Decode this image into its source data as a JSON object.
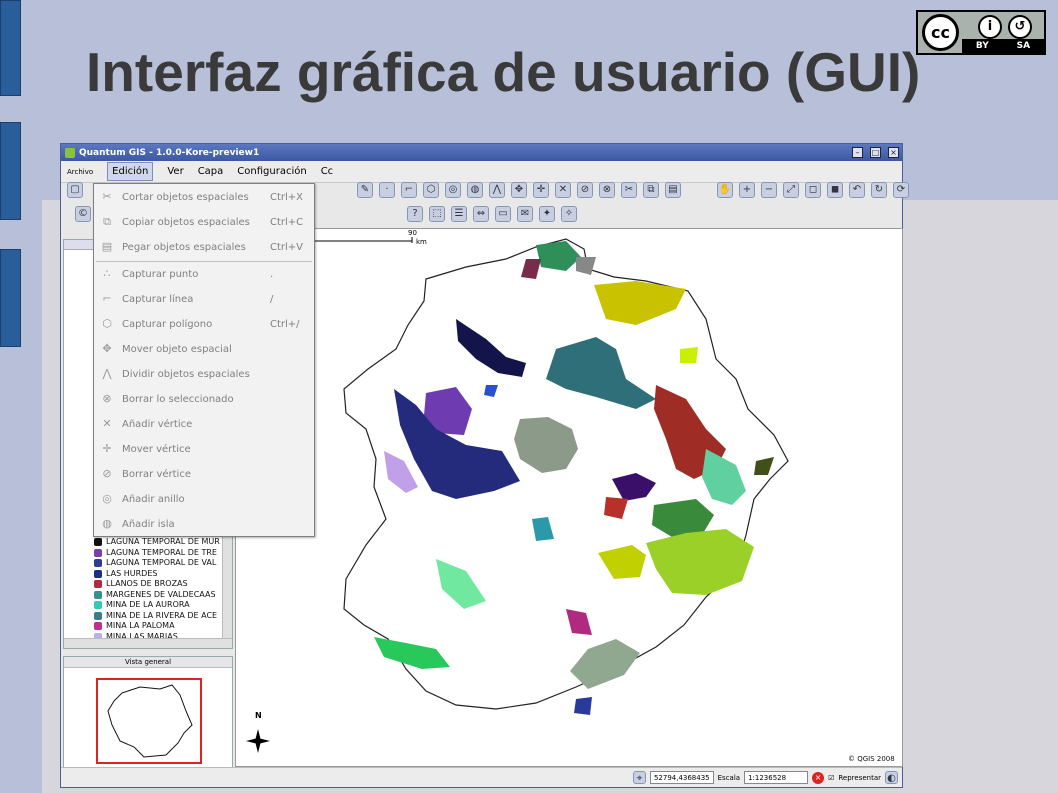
{
  "slide": {
    "title": "Interfaz gráfica de usuario (GUI)"
  },
  "license": {
    "cc": "cc",
    "by": "BY",
    "sa": "SA"
  },
  "window": {
    "title": "Quantum GIS - 1.0.0-Kore-preview1"
  },
  "menubar": {
    "archivo": "Archivo",
    "edicion": "Edición",
    "ver": "Ver",
    "capa": "Capa",
    "configuracion": "Configuración",
    "complementos": "Cc"
  },
  "edit_menu": [
    {
      "label": "Cortar objetos espaciales",
      "shortcut": "Ctrl+X",
      "icon": "scissors-icon"
    },
    {
      "label": "Copiar objetos espaciales",
      "shortcut": "Ctrl+C",
      "icon": "copy-icon"
    },
    {
      "label": "Pegar objetos espaciales",
      "shortcut": "Ctrl+V",
      "icon": "paste-icon"
    },
    {
      "label": "Capturar punto",
      "shortcut": ".",
      "icon": "capture-point-icon"
    },
    {
      "label": "Capturar línea",
      "shortcut": "/",
      "icon": "capture-line-icon"
    },
    {
      "label": "Capturar polígono",
      "shortcut": "Ctrl+/",
      "icon": "capture-polygon-icon"
    },
    {
      "label": "Mover objeto espacial",
      "shortcut": "",
      "icon": "move-feature-icon"
    },
    {
      "label": "Dividir objetos espaciales",
      "shortcut": "",
      "icon": "split-feature-icon"
    },
    {
      "label": "Borrar lo seleccionado",
      "shortcut": "",
      "icon": "delete-selected-icon"
    },
    {
      "label": "Añadir vértice",
      "shortcut": "",
      "icon": "add-vertex-icon"
    },
    {
      "label": "Mover vértice",
      "shortcut": "",
      "icon": "move-vertex-icon"
    },
    {
      "label": "Borrar vértice",
      "shortcut": "",
      "icon": "delete-vertex-icon"
    },
    {
      "label": "Añadir anillo",
      "shortcut": "",
      "icon": "add-ring-icon"
    },
    {
      "label": "Añadir isla",
      "shortcut": "",
      "icon": "add-island-icon"
    }
  ],
  "legend": [
    {
      "label": "LAGUNA TEMPORAL DE MUR",
      "color": "#111111"
    },
    {
      "label": "LAGUNA TEMPORAL DE TRE",
      "color": "#7b3ea8"
    },
    {
      "label": "LAGUNA TEMPORAL DE VAL",
      "color": "#2b3f8e"
    },
    {
      "label": "LAS HURDES",
      "color": "#1c2f80"
    },
    {
      "label": "LLANOS DE BROZAS",
      "color": "#b02a40"
    },
    {
      "label": "MARGENES DE VALDECAAS",
      "color": "#3a8f8f"
    },
    {
      "label": "MINA DE LA AURORA",
      "color": "#38c8b8"
    },
    {
      "label": "MINA DE LA RIVERA DE ACE",
      "color": "#3a7e8a"
    },
    {
      "label": "MINA LA PALOMA",
      "color": "#c02f8f"
    },
    {
      "label": "MINA LAS MARIAS",
      "color": "#b8b0e8"
    }
  ],
  "overview": {
    "title": "Vista general"
  },
  "map": {
    "scale_label": "90",
    "scale_unit": "km",
    "north": "N",
    "credit": "© QGIS 2008"
  },
  "statusbar": {
    "coords": "52794,4368435",
    "scale_label": "Escala",
    "scale_value": "1:1236528",
    "render_label": "Representar"
  }
}
